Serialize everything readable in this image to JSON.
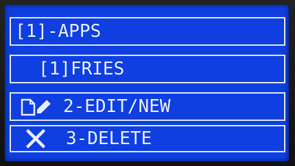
{
  "display": {
    "screen_color": "#0f3fe0",
    "text_color": "#e9eeff"
  },
  "menu": {
    "title": "[1]-APPS",
    "selected_item": "[1]FRIES",
    "items": [
      {
        "icon": "document-pencil-icon",
        "label": "2-EDIT/NEW"
      },
      {
        "icon": "close-x-icon",
        "label": "3-DELETE"
      }
    ]
  }
}
